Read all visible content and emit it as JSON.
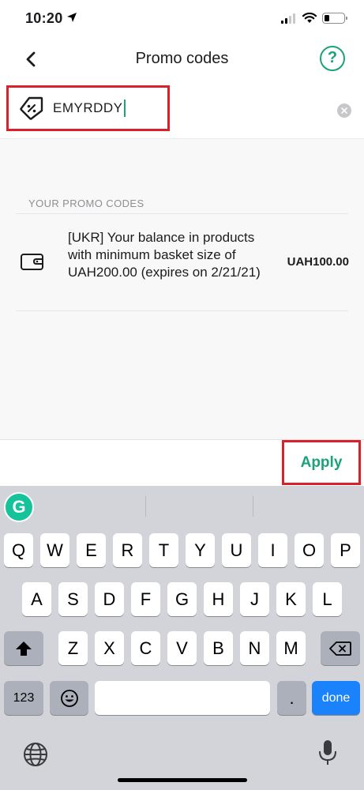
{
  "status_bar": {
    "time": "10:20"
  },
  "nav": {
    "title": "Promo codes",
    "help_label": "?"
  },
  "promo_input": {
    "value": "EMYRDDY"
  },
  "section": {
    "header": "YOUR PROMO CODES"
  },
  "promos": [
    {
      "description": "[UKR] Your balance in products with minimum basket size of UAH200.00 (expires on 2/21/21)",
      "amount": "UAH100.00"
    }
  ],
  "apply": {
    "label": "Apply"
  },
  "keyboard": {
    "grammarly": "G",
    "row1": [
      "Q",
      "W",
      "E",
      "R",
      "T",
      "Y",
      "U",
      "I",
      "O",
      "P"
    ],
    "row2": [
      "A",
      "S",
      "D",
      "F",
      "G",
      "H",
      "J",
      "K",
      "L"
    ],
    "row3": [
      "Z",
      "X",
      "C",
      "V",
      "B",
      "N",
      "M"
    ],
    "numbers_key": "123",
    "period_key": ".",
    "done_key": "done"
  },
  "colors": {
    "accent": "#1ba27a",
    "highlight": "#d9202b",
    "done_blue": "#1a82fb"
  }
}
